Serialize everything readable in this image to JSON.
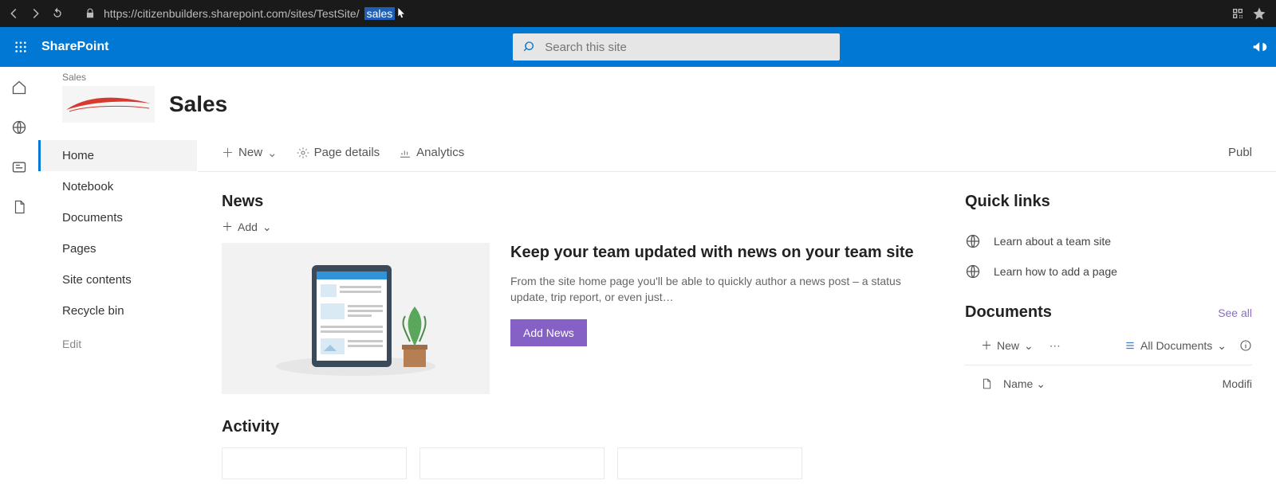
{
  "browser": {
    "url_prefix": "https://citizenbuilders.sharepoint.com/sites/TestSite/",
    "url_selected": "sales"
  },
  "header": {
    "app_title": "SharePoint",
    "search_placeholder": "Search this site"
  },
  "site": {
    "label": "Sales",
    "title": "Sales"
  },
  "nav": {
    "items": [
      "Home",
      "Notebook",
      "Documents",
      "Pages",
      "Site contents",
      "Recycle bin"
    ],
    "edit": "Edit"
  },
  "cmd": {
    "new": "New",
    "page_details": "Page details",
    "analytics": "Analytics",
    "publish": "Publ"
  },
  "news": {
    "section": "News",
    "add": "Add",
    "heading": "Keep your team updated with news on your team site",
    "desc": "From the site home page you'll be able to quickly author a news post – a status update, trip report, or even just…",
    "button": "Add News"
  },
  "activity": {
    "section": "Activity"
  },
  "quicklinks": {
    "section": "Quick links",
    "items": [
      "Learn about a team site",
      "Learn how to add a page"
    ]
  },
  "documents": {
    "section": "Documents",
    "see_all": "See all",
    "new": "New",
    "view": "All Documents",
    "col_name": "Name",
    "col_modified": "Modifi"
  }
}
